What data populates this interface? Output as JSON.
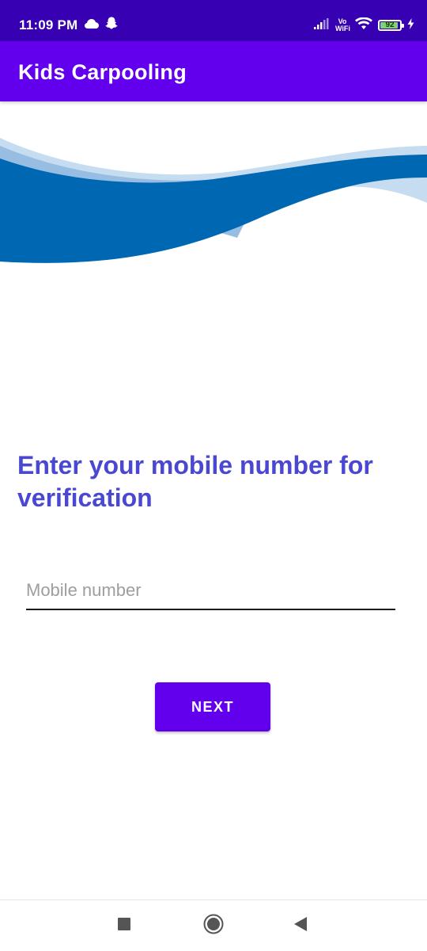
{
  "status_bar": {
    "time": "11:09 PM",
    "vowifi_top": "Vo",
    "vowifi_bottom": "WiFi",
    "battery_level": "92",
    "battery_fraction": 0.92
  },
  "app_bar": {
    "title": "Kids Carpooling"
  },
  "verification": {
    "heading": "Enter your mobile number for verification",
    "mobile_placeholder": "Mobile number",
    "mobile_value": "",
    "next_label": "NEXT"
  },
  "colors": {
    "status_bar": "#3700b3",
    "app_bar": "#6200ee",
    "heading": "#4a48d2",
    "button": "#6200ee",
    "wave_dark": "#0068b2",
    "wave_light": "#c6dcf1",
    "wave_mid": "#97bde2"
  },
  "icons": {
    "status_left": [
      "cloud-icon",
      "snapchat-icon"
    ],
    "status_right": [
      "signal-icon",
      "vowifi-icon",
      "wifi-icon",
      "battery-icon",
      "charging-icon"
    ],
    "navigation": [
      "recents-icon",
      "home-icon",
      "back-icon"
    ]
  }
}
